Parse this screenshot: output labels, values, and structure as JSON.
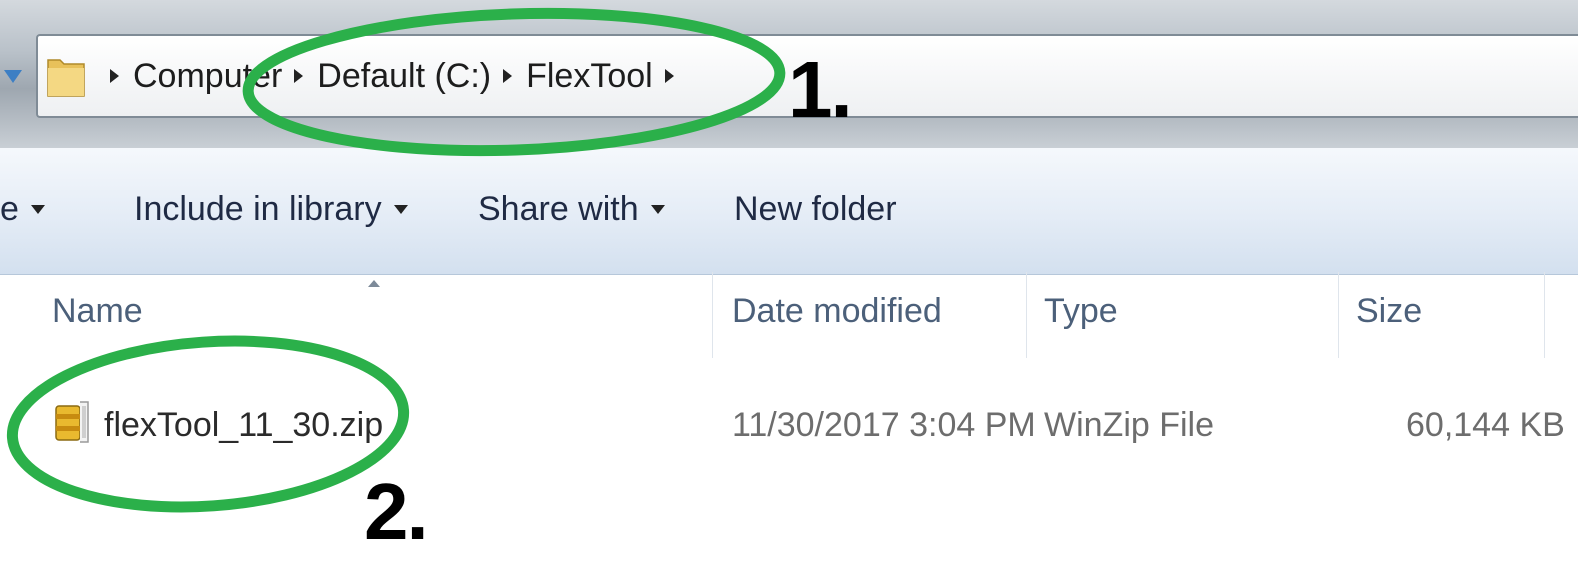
{
  "address_bar": {
    "breadcrumbs": [
      "Computer",
      "Default (C:)",
      "FlexTool"
    ]
  },
  "annotations": {
    "step1": "1.",
    "step2": "2."
  },
  "toolbar": {
    "partial_item": "e",
    "include_in_library": "Include in library",
    "share_with": "Share with",
    "new_folder": "New folder"
  },
  "columns": {
    "name": "Name",
    "date_modified": "Date modified",
    "type": "Type",
    "size": "Size"
  },
  "files": [
    {
      "name": "flexTool_11_30.zip",
      "date_modified": "11/30/2017 3:04 PM",
      "type": "WinZip File",
      "size": "60,144 KB"
    }
  ],
  "icons": {
    "nav": "nav-down-arrow-icon",
    "folder": "folder-icon",
    "file": "winzip-file-icon"
  },
  "colors": {
    "annotation_oval": "#2bb04a",
    "toolbar_text": "#1f2a44",
    "column_header_text": "#4c607a"
  }
}
